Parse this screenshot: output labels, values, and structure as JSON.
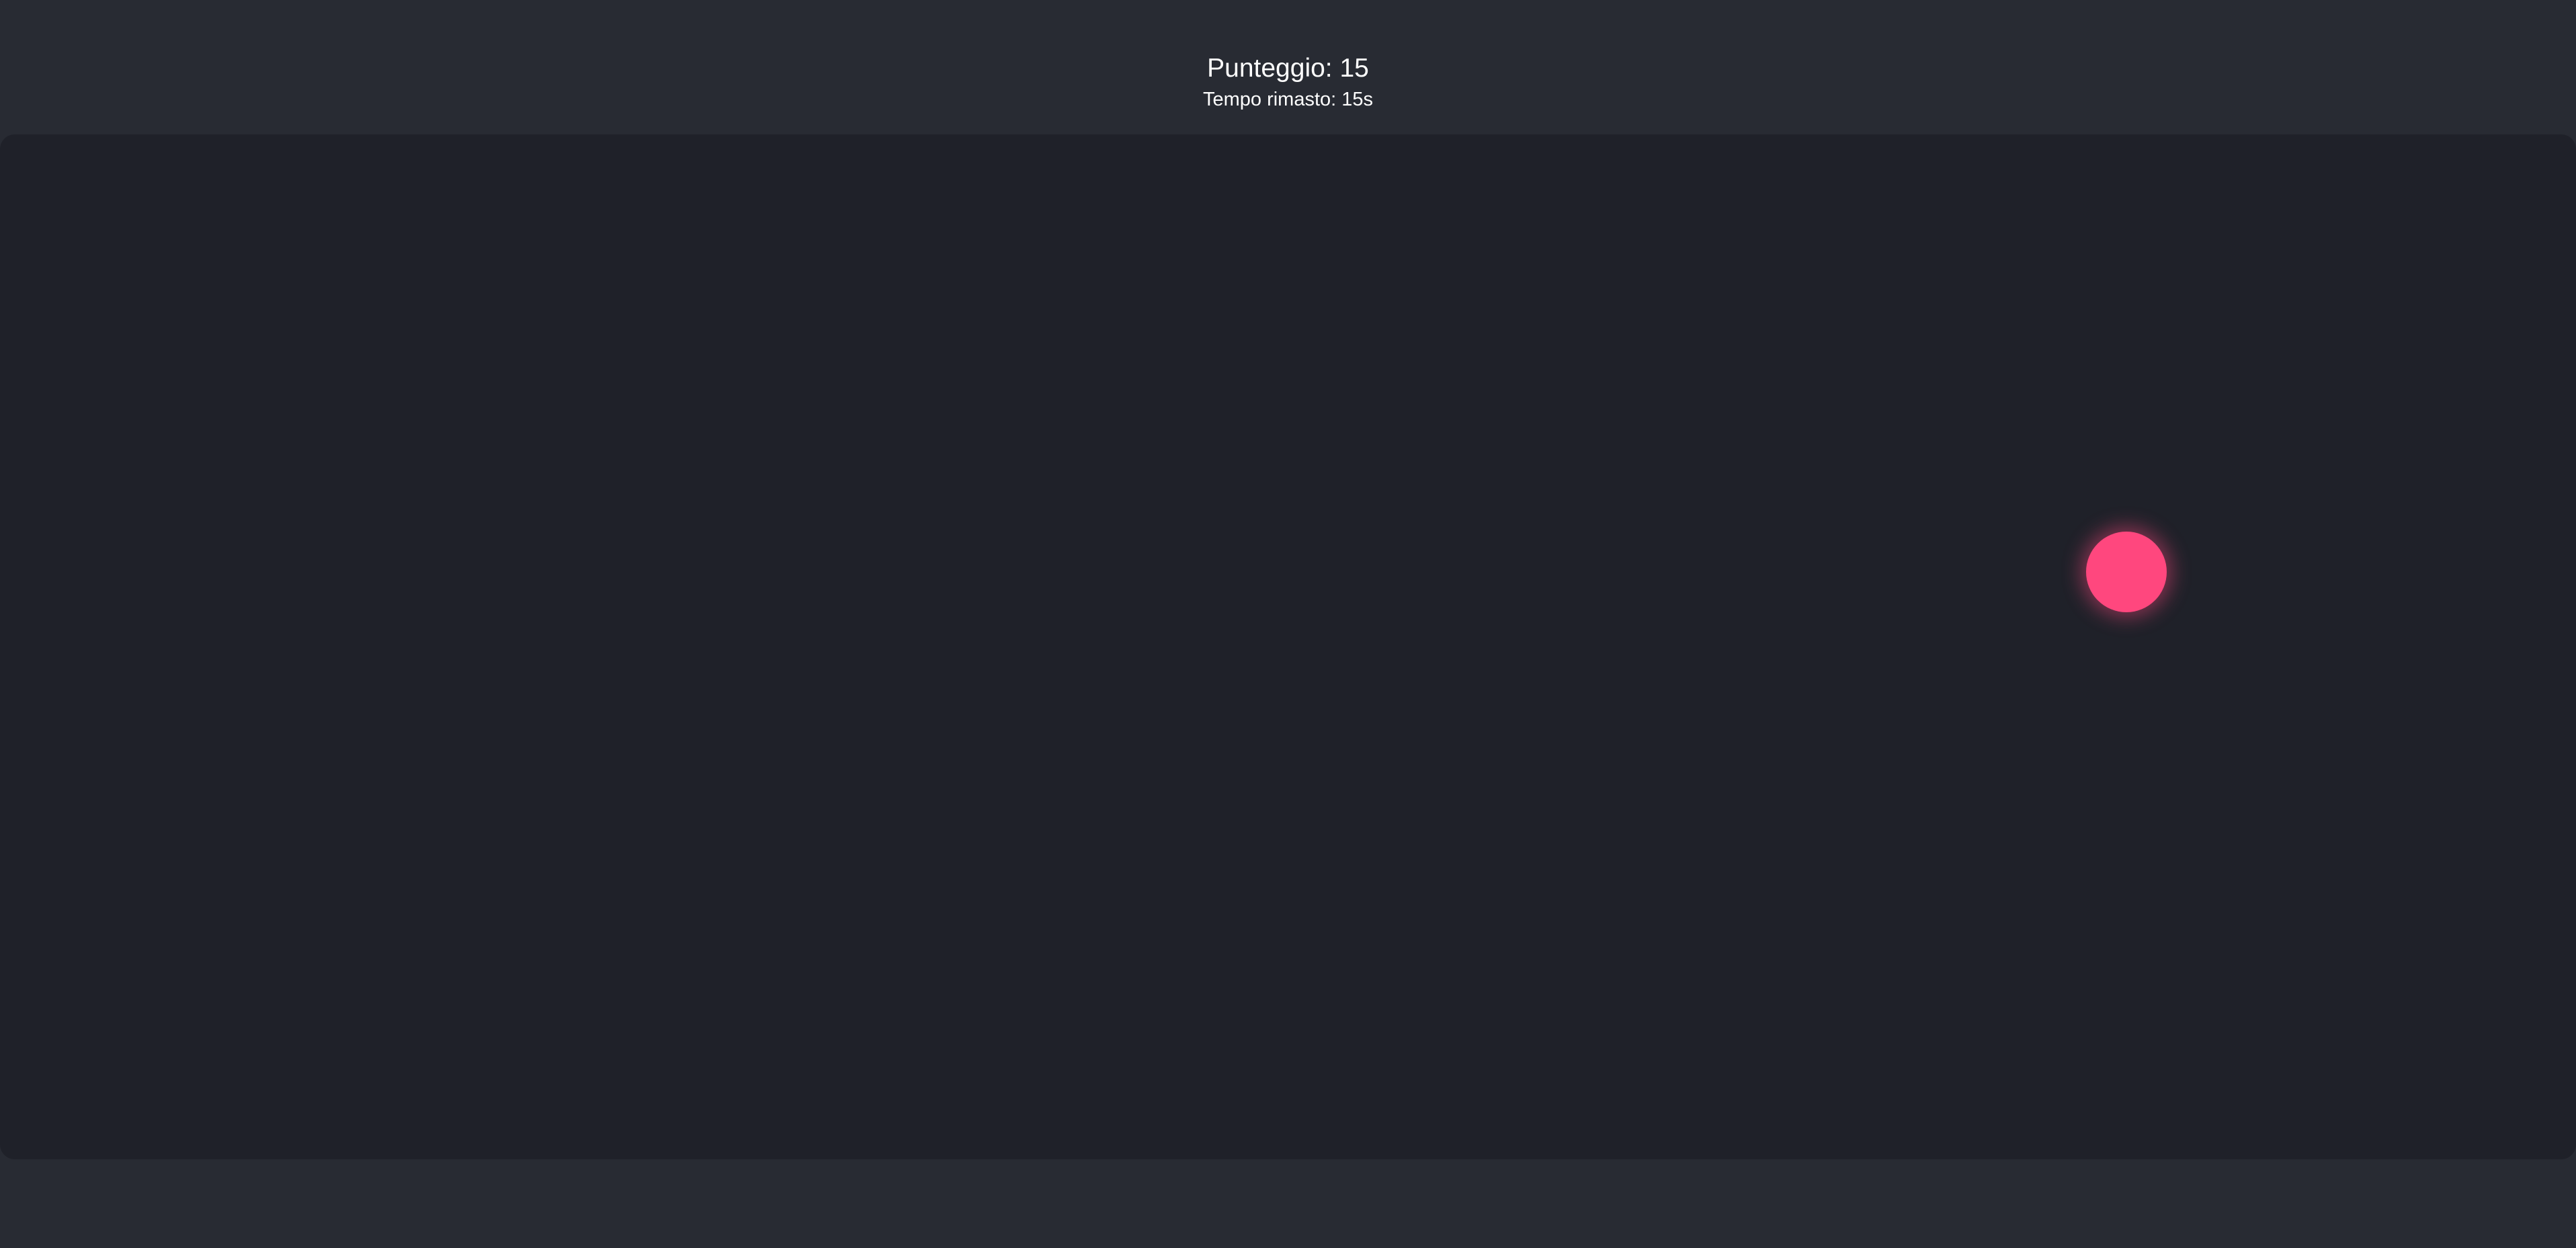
{
  "hud": {
    "score_text": "Punteggio: 15",
    "time_text": "Tempo rimasto: 15s"
  },
  "colors": {
    "page_background": "#282b33",
    "play_area_background": "#1f2129",
    "target": "#ff477e",
    "target_glow": "rgba(255, 71, 126, 0.45)",
    "text": "#ffffff"
  },
  "target": {
    "shape": "circle"
  }
}
